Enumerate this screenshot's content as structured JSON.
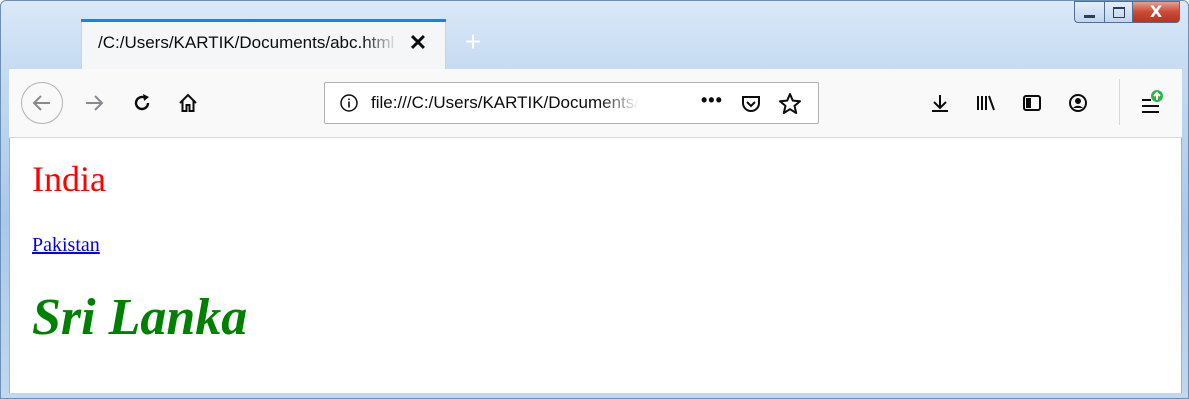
{
  "window": {
    "caption": {
      "close_glyph": "X"
    }
  },
  "tab": {
    "title": "/C:/Users/KARTIK/Documents/abc.html",
    "close_glyph": "✕",
    "new_tab_glyph": "+"
  },
  "toolbar": {
    "url": "file:///C:/Users/KARTIK/Documents/abc.html",
    "page_actions_glyph": "•••",
    "accent_color": "#0a84ff",
    "update_badge_color": "#30b24b"
  },
  "page": {
    "heading": "India",
    "heading_color": "#ff0000",
    "link": "Pakistan",
    "link_color": "#0000ee",
    "subheading": "Sri Lanka",
    "subheading_color": "#008000"
  }
}
